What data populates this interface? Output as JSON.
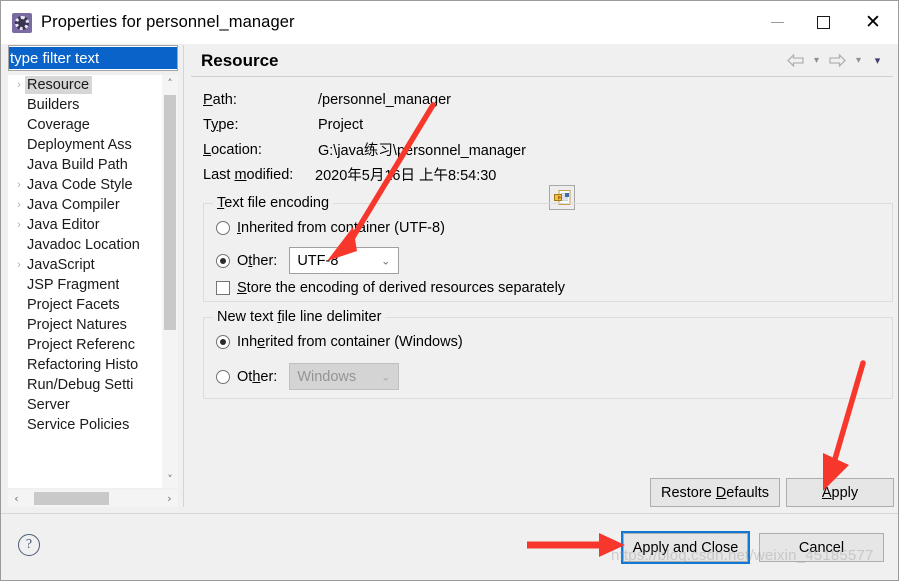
{
  "window": {
    "title": "Properties for personnel_manager",
    "app_icon": "gear-icon",
    "minimize_label": "Minimize",
    "maximize_label": "Maximize",
    "close_label": "Close"
  },
  "filter": {
    "value": "type filter text",
    "placeholder": "type filter text"
  },
  "tree": {
    "items": [
      {
        "label": "Resource",
        "expandable": true,
        "selected": true
      },
      {
        "label": "Builders",
        "expandable": false,
        "selected": false
      },
      {
        "label": "Coverage",
        "expandable": false,
        "selected": false
      },
      {
        "label": "Deployment Ass",
        "expandable": false,
        "selected": false
      },
      {
        "label": "Java Build Path",
        "expandable": false,
        "selected": false
      },
      {
        "label": "Java Code Style",
        "expandable": true,
        "selected": false
      },
      {
        "label": "Java Compiler",
        "expandable": true,
        "selected": false
      },
      {
        "label": "Java Editor",
        "expandable": true,
        "selected": false
      },
      {
        "label": "Javadoc Location",
        "expandable": false,
        "selected": false
      },
      {
        "label": "JavaScript",
        "expandable": true,
        "selected": false
      },
      {
        "label": "JSP Fragment",
        "expandable": false,
        "selected": false
      },
      {
        "label": "Project Facets",
        "expandable": false,
        "selected": false
      },
      {
        "label": "Project Natures",
        "expandable": false,
        "selected": false
      },
      {
        "label": "Project Referenc",
        "expandable": false,
        "selected": false
      },
      {
        "label": "Refactoring Histo",
        "expandable": false,
        "selected": false
      },
      {
        "label": "Run/Debug Setti",
        "expandable": false,
        "selected": false
      },
      {
        "label": "Server",
        "expandable": false,
        "selected": false
      },
      {
        "label": "Service Policies",
        "expandable": false,
        "selected": false
      }
    ],
    "scroll_up": "˄",
    "scroll_down": "˅",
    "scroll_left": "‹",
    "scroll_right": "›"
  },
  "page": {
    "title": "Resource",
    "nav": {
      "back": "back-arrow-icon",
      "back_menu": "▾",
      "forward": "forward-arrow-icon",
      "forward_menu": "▾",
      "view_menu": "▾"
    },
    "info": [
      {
        "label": "Path:",
        "underline": "P",
        "value": "/personnel_manager"
      },
      {
        "label": "Type:",
        "underline": "y",
        "value": "Project"
      },
      {
        "label": "Location:",
        "underline": "L",
        "value": "G:\\java练习\\personnel_manager"
      },
      {
        "label": "Last modified:",
        "underline": "m",
        "value": "2020年5月16日 上午8:54:30"
      }
    ],
    "location_button_icon": "copy-path-icon",
    "encoding_group": {
      "legend": "Text file encoding",
      "inherited_label": "Inherited from container (UTF-8)",
      "inherited_selected": false,
      "other_label": "Other:",
      "other_selected": true,
      "other_value": "UTF-8",
      "store_derived_label": "Store the encoding of derived resources separately",
      "store_derived_checked": false
    },
    "delimiter_group": {
      "legend": "New text file line delimiter",
      "inherited_label": "Inherited from container (Windows)",
      "inherited_selected": true,
      "other_label": "Other:",
      "other_selected": false,
      "other_value": "Windows",
      "other_disabled": true
    }
  },
  "buttons": {
    "restore_defaults": "Restore Defaults",
    "apply": "Apply",
    "apply_and_close": "Apply and Close",
    "cancel": "Cancel",
    "help": "?"
  },
  "annotations": {
    "arrow_color": "#f8372c",
    "watermark": "https://blog.csdn.net/weixin_45185577"
  }
}
